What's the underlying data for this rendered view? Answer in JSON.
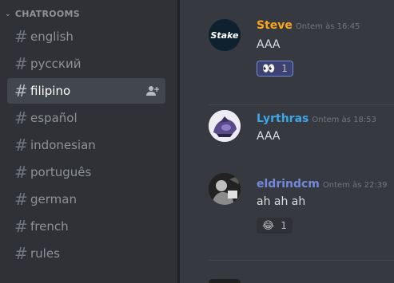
{
  "sidebar": {
    "category": "CHATROOMS",
    "channels": [
      {
        "name": "english"
      },
      {
        "name": "русский"
      },
      {
        "name": "filipino"
      },
      {
        "name": "español"
      },
      {
        "name": "indonesian"
      },
      {
        "name": "português"
      },
      {
        "name": "german"
      },
      {
        "name": "french"
      },
      {
        "name": "rules"
      }
    ],
    "selected": "filipino"
  },
  "messages": [
    {
      "author": "Steve",
      "author_color": "#faa61a",
      "timestamp": "Ontem às 16:45",
      "text": "AAA",
      "avatar": "stake-logo",
      "avatar_text": "Stake",
      "reaction": {
        "emoji": "👀",
        "count": "1"
      }
    },
    {
      "author": "Lyrthras",
      "author_color": "#3ea6e6",
      "timestamp": "Ontem às 18:53",
      "text": "AAA",
      "avatar": "character-avatar"
    },
    {
      "author": "eldrindcm",
      "author_color": "#7289da",
      "timestamp": "Ontem às 22:39",
      "text": "ah ah ah",
      "avatar": "photo-avatar",
      "reaction": {
        "emoji": "😂",
        "count": "1"
      }
    }
  ],
  "colors": {
    "accent": "#7289da",
    "sidebar_bg": "#2f3136",
    "chat_bg": "#36393f"
  }
}
